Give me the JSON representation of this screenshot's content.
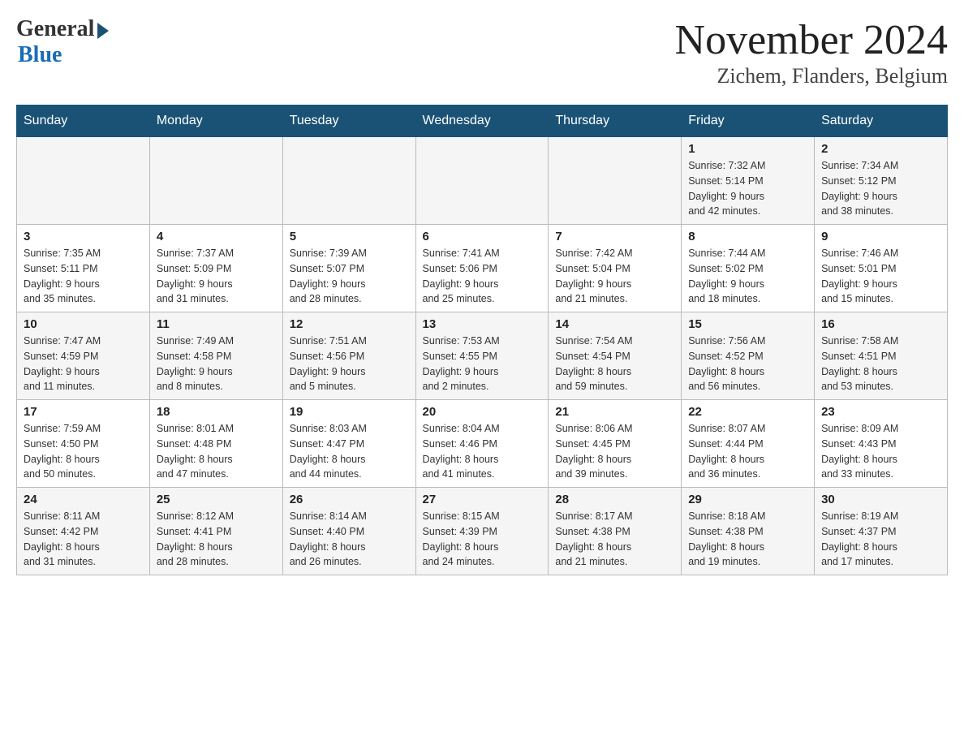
{
  "header": {
    "logo": {
      "general_text": "General",
      "blue_text": "Blue"
    },
    "title": "November 2024",
    "location": "Zichem, Flanders, Belgium"
  },
  "days_of_week": [
    "Sunday",
    "Monday",
    "Tuesday",
    "Wednesday",
    "Thursday",
    "Friday",
    "Saturday"
  ],
  "weeks": [
    {
      "days": [
        {
          "number": "",
          "info": ""
        },
        {
          "number": "",
          "info": ""
        },
        {
          "number": "",
          "info": ""
        },
        {
          "number": "",
          "info": ""
        },
        {
          "number": "",
          "info": ""
        },
        {
          "number": "1",
          "info": "Sunrise: 7:32 AM\nSunset: 5:14 PM\nDaylight: 9 hours\nand 42 minutes."
        },
        {
          "number": "2",
          "info": "Sunrise: 7:34 AM\nSunset: 5:12 PM\nDaylight: 9 hours\nand 38 minutes."
        }
      ]
    },
    {
      "days": [
        {
          "number": "3",
          "info": "Sunrise: 7:35 AM\nSunset: 5:11 PM\nDaylight: 9 hours\nand 35 minutes."
        },
        {
          "number": "4",
          "info": "Sunrise: 7:37 AM\nSunset: 5:09 PM\nDaylight: 9 hours\nand 31 minutes."
        },
        {
          "number": "5",
          "info": "Sunrise: 7:39 AM\nSunset: 5:07 PM\nDaylight: 9 hours\nand 28 minutes."
        },
        {
          "number": "6",
          "info": "Sunrise: 7:41 AM\nSunset: 5:06 PM\nDaylight: 9 hours\nand 25 minutes."
        },
        {
          "number": "7",
          "info": "Sunrise: 7:42 AM\nSunset: 5:04 PM\nDaylight: 9 hours\nand 21 minutes."
        },
        {
          "number": "8",
          "info": "Sunrise: 7:44 AM\nSunset: 5:02 PM\nDaylight: 9 hours\nand 18 minutes."
        },
        {
          "number": "9",
          "info": "Sunrise: 7:46 AM\nSunset: 5:01 PM\nDaylight: 9 hours\nand 15 minutes."
        }
      ]
    },
    {
      "days": [
        {
          "number": "10",
          "info": "Sunrise: 7:47 AM\nSunset: 4:59 PM\nDaylight: 9 hours\nand 11 minutes."
        },
        {
          "number": "11",
          "info": "Sunrise: 7:49 AM\nSunset: 4:58 PM\nDaylight: 9 hours\nand 8 minutes."
        },
        {
          "number": "12",
          "info": "Sunrise: 7:51 AM\nSunset: 4:56 PM\nDaylight: 9 hours\nand 5 minutes."
        },
        {
          "number": "13",
          "info": "Sunrise: 7:53 AM\nSunset: 4:55 PM\nDaylight: 9 hours\nand 2 minutes."
        },
        {
          "number": "14",
          "info": "Sunrise: 7:54 AM\nSunset: 4:54 PM\nDaylight: 8 hours\nand 59 minutes."
        },
        {
          "number": "15",
          "info": "Sunrise: 7:56 AM\nSunset: 4:52 PM\nDaylight: 8 hours\nand 56 minutes."
        },
        {
          "number": "16",
          "info": "Sunrise: 7:58 AM\nSunset: 4:51 PM\nDaylight: 8 hours\nand 53 minutes."
        }
      ]
    },
    {
      "days": [
        {
          "number": "17",
          "info": "Sunrise: 7:59 AM\nSunset: 4:50 PM\nDaylight: 8 hours\nand 50 minutes."
        },
        {
          "number": "18",
          "info": "Sunrise: 8:01 AM\nSunset: 4:48 PM\nDaylight: 8 hours\nand 47 minutes."
        },
        {
          "number": "19",
          "info": "Sunrise: 8:03 AM\nSunset: 4:47 PM\nDaylight: 8 hours\nand 44 minutes."
        },
        {
          "number": "20",
          "info": "Sunrise: 8:04 AM\nSunset: 4:46 PM\nDaylight: 8 hours\nand 41 minutes."
        },
        {
          "number": "21",
          "info": "Sunrise: 8:06 AM\nSunset: 4:45 PM\nDaylight: 8 hours\nand 39 minutes."
        },
        {
          "number": "22",
          "info": "Sunrise: 8:07 AM\nSunset: 4:44 PM\nDaylight: 8 hours\nand 36 minutes."
        },
        {
          "number": "23",
          "info": "Sunrise: 8:09 AM\nSunset: 4:43 PM\nDaylight: 8 hours\nand 33 minutes."
        }
      ]
    },
    {
      "days": [
        {
          "number": "24",
          "info": "Sunrise: 8:11 AM\nSunset: 4:42 PM\nDaylight: 8 hours\nand 31 minutes."
        },
        {
          "number": "25",
          "info": "Sunrise: 8:12 AM\nSunset: 4:41 PM\nDaylight: 8 hours\nand 28 minutes."
        },
        {
          "number": "26",
          "info": "Sunrise: 8:14 AM\nSunset: 4:40 PM\nDaylight: 8 hours\nand 26 minutes."
        },
        {
          "number": "27",
          "info": "Sunrise: 8:15 AM\nSunset: 4:39 PM\nDaylight: 8 hours\nand 24 minutes."
        },
        {
          "number": "28",
          "info": "Sunrise: 8:17 AM\nSunset: 4:38 PM\nDaylight: 8 hours\nand 21 minutes."
        },
        {
          "number": "29",
          "info": "Sunrise: 8:18 AM\nSunset: 4:38 PM\nDaylight: 8 hours\nand 19 minutes."
        },
        {
          "number": "30",
          "info": "Sunrise: 8:19 AM\nSunset: 4:37 PM\nDaylight: 8 hours\nand 17 minutes."
        }
      ]
    }
  ]
}
